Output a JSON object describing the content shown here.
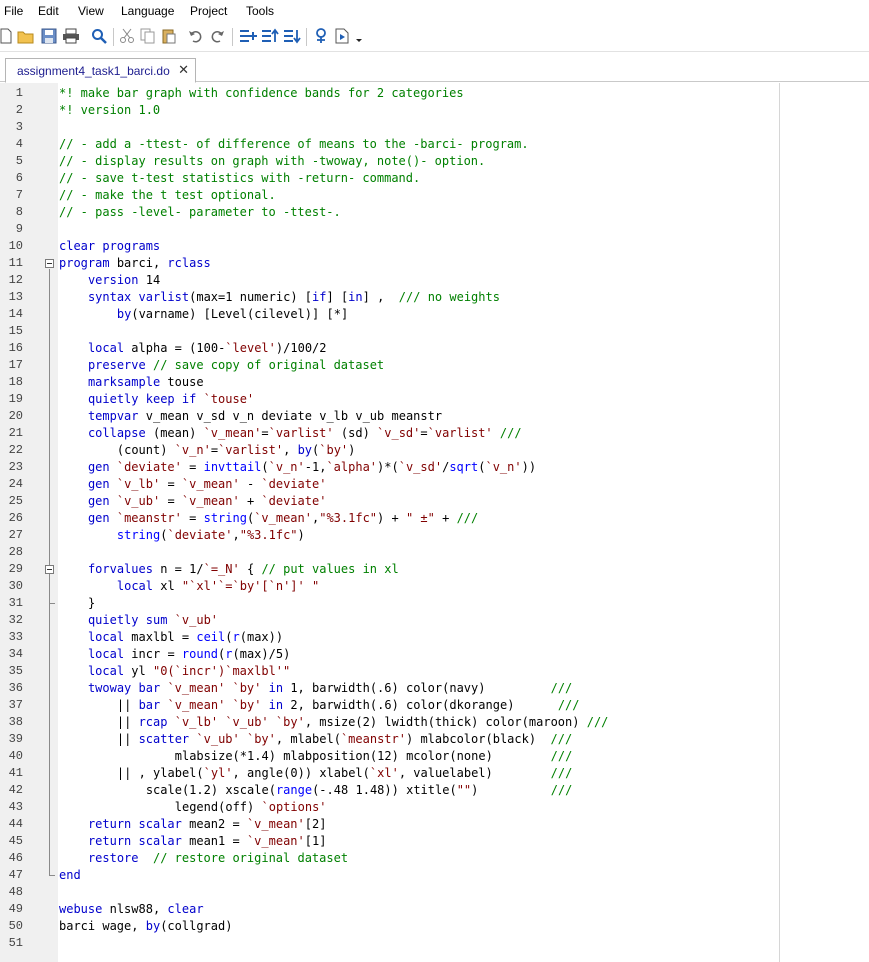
{
  "menu": {
    "file": "File",
    "edit": "Edit",
    "view": "View",
    "language": "Language",
    "project": "Project",
    "tools": "Tools"
  },
  "toolbar": {
    "icons": [
      "new-file-icon",
      "open-folder-icon",
      "save-icon",
      "print-icon",
      "find-icon",
      "cut-icon",
      "copy-icon",
      "paste-icon",
      "undo-icon",
      "redo-icon",
      "add-bookmark-icon",
      "previous-bookmark-icon",
      "next-bookmark-icon",
      "show-hide-icon",
      "run-icon",
      "dropdown-arrow-icon"
    ]
  },
  "tab": {
    "label": "assignment4_task1_barci.do",
    "close": "✕"
  },
  "colors": {
    "comment": "#008000",
    "keyword": "#0000cc",
    "string": "#800000",
    "text": "#000000",
    "function": "#0000ff"
  },
  "editor": {
    "lines": [
      {
        "n": "1",
        "t": "*! make bar graph with confidence bands for 2 categories"
      },
      {
        "n": "2",
        "t": "*! version 1.0"
      },
      {
        "n": "3",
        "t": ""
      },
      {
        "n": "4",
        "t": "// - add a -ttest- of difference of means to the -barci- program."
      },
      {
        "n": "5",
        "t": "// - display results on graph with -twoway, note()- option."
      },
      {
        "n": "6",
        "t": "// - save t-test statistics with -return- command."
      },
      {
        "n": "7",
        "t": "// - make the t test optional."
      },
      {
        "n": "8",
        "t": "// - pass -level- parameter to -ttest-."
      },
      {
        "n": "9",
        "t": ""
      },
      {
        "n": "10",
        "t": "clear programs"
      },
      {
        "n": "11",
        "t": "program barci, rclass"
      },
      {
        "n": "12",
        "t": "    version 14"
      },
      {
        "n": "13",
        "t": "    syntax varlist(max=1 numeric) [if] [in] ,  /// no weights"
      },
      {
        "n": "14",
        "t": "        by(varname) [Level(cilevel)] [*]"
      },
      {
        "n": "15",
        "t": ""
      },
      {
        "n": "16",
        "t": "    local alpha = (100-`level')/100/2"
      },
      {
        "n": "17",
        "t": "    preserve // save copy of original dataset"
      },
      {
        "n": "18",
        "t": "    marksample touse"
      },
      {
        "n": "19",
        "t": "    quietly keep if `touse'"
      },
      {
        "n": "20",
        "t": "    tempvar v_mean v_sd v_n deviate v_lb v_ub meanstr"
      },
      {
        "n": "21",
        "t": "    collapse (mean) `v_mean'=`varlist' (sd) `v_sd'=`varlist' ///"
      },
      {
        "n": "22",
        "t": "        (count) `v_n'=`varlist', by(`by')"
      },
      {
        "n": "23",
        "t": "    gen `deviate' = invttail(`v_n'-1,`alpha')*(`v_sd'/sqrt(`v_n'))"
      },
      {
        "n": "24",
        "t": "    gen `v_lb' = `v_mean' - `deviate'"
      },
      {
        "n": "25",
        "t": "    gen `v_ub' = `v_mean' + `deviate'"
      },
      {
        "n": "26",
        "t": "    gen `meanstr' = string(`v_mean',\"%3.1fc\") + \" ±\" + ///"
      },
      {
        "n": "27",
        "t": "        string(`deviate',\"%3.1fc\")"
      },
      {
        "n": "28",
        "t": ""
      },
      {
        "n": "29",
        "t": "    forvalues n = 1/`=_N' { // put values in xl"
      },
      {
        "n": "30",
        "t": "        local xl \"`xl'`=`by'[`n']' \""
      },
      {
        "n": "31",
        "t": "    }"
      },
      {
        "n": "32",
        "t": "    quietly sum `v_ub'"
      },
      {
        "n": "33",
        "t": "    local maxlbl = ceil(r(max))"
      },
      {
        "n": "34",
        "t": "    local incr = round(r(max)/5)"
      },
      {
        "n": "35",
        "t": "    local yl \"0(`incr')`maxlbl'\""
      },
      {
        "n": "36",
        "t": "    twoway bar `v_mean' `by' in 1, barwidth(.6) color(navy)         ///"
      },
      {
        "n": "37",
        "t": "        || bar `v_mean' `by' in 2, barwidth(.6) color(dkorange)      ///"
      },
      {
        "n": "38",
        "t": "        || rcap `v_lb' `v_ub' `by', msize(2) lwidth(thick) color(maroon) ///"
      },
      {
        "n": "39",
        "t": "        || scatter `v_ub' `by', mlabel(`meanstr') mlabcolor(black)  ///"
      },
      {
        "n": "40",
        "t": "                mlabsize(*1.4) mlabposition(12) mcolor(none)        ///"
      },
      {
        "n": "41",
        "t": "        || , ylabel(`yl', angle(0)) xlabel(`xl', valuelabel)        ///"
      },
      {
        "n": "42",
        "t": "            scale(1.2) xscale(range(-.48 1.48)) xtitle(\"\")          ///"
      },
      {
        "n": "43",
        "t": "                legend(off) `options'"
      },
      {
        "n": "44",
        "t": "    return scalar mean2 = `v_mean'[2]"
      },
      {
        "n": "45",
        "t": "    return scalar mean1 = `v_mean'[1]"
      },
      {
        "n": "46",
        "t": "    restore  // restore original dataset"
      },
      {
        "n": "47",
        "t": "end"
      },
      {
        "n": "48",
        "t": ""
      },
      {
        "n": "49",
        "t": "webuse nlsw88, clear"
      },
      {
        "n": "50",
        "t": "barci wage, by(collgrad)"
      },
      {
        "n": "51",
        "t": ""
      }
    ]
  }
}
